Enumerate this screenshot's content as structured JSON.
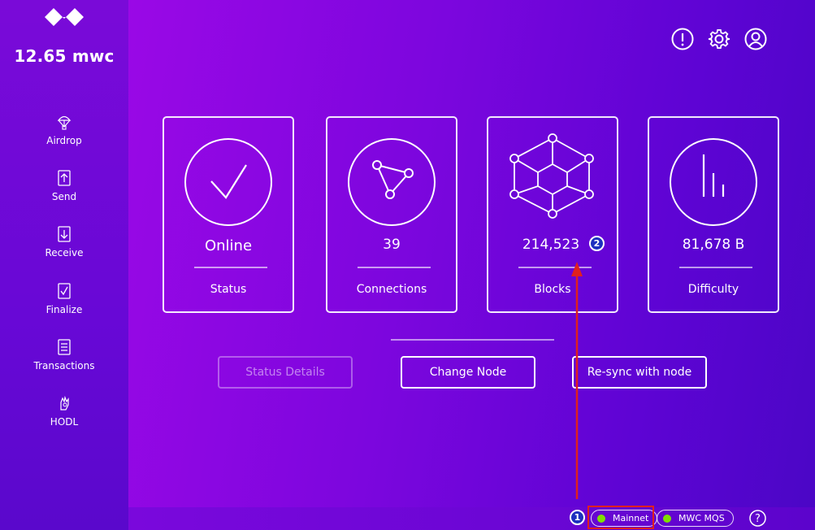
{
  "sidebar": {
    "balance": "12.65 mwc",
    "items": [
      {
        "label": "Airdrop",
        "icon": "parachute-icon"
      },
      {
        "label": "Send",
        "icon": "send-icon"
      },
      {
        "label": "Receive",
        "icon": "receive-icon"
      },
      {
        "label": "Finalize",
        "icon": "finalize-icon"
      },
      {
        "label": "Transactions",
        "icon": "transactions-icon"
      },
      {
        "label": "HODL",
        "icon": "hodl-icon"
      }
    ]
  },
  "header": {
    "icons": [
      "info-icon",
      "gear-icon",
      "account-icon"
    ]
  },
  "cards": [
    {
      "value": "Online",
      "label": "Status",
      "icon": "checkmark-icon"
    },
    {
      "value": "39",
      "label": "Connections",
      "icon": "network-icon"
    },
    {
      "value": "214,523",
      "label": "Blocks",
      "icon": "cube-icon"
    },
    {
      "value": "81,678 B",
      "label": "Difficulty",
      "icon": "bars-icon"
    }
  ],
  "buttons": {
    "status_details": "Status Details",
    "change_node": "Change Node",
    "resync": "Re-sync with node"
  },
  "statusbar": {
    "network": "Mainnet",
    "mqs": "MWC MQS",
    "help": "?",
    "indicator_color": "#7fe000"
  },
  "annotations": {
    "step1": "1",
    "step2": "2",
    "highlight_color": "#e0201e",
    "marker_color": "#1d2fbf"
  },
  "colors": {
    "accent": "#6a06d6",
    "main_gradient_start": "#9a08e6",
    "main_gradient_end": "#4b06c6"
  }
}
